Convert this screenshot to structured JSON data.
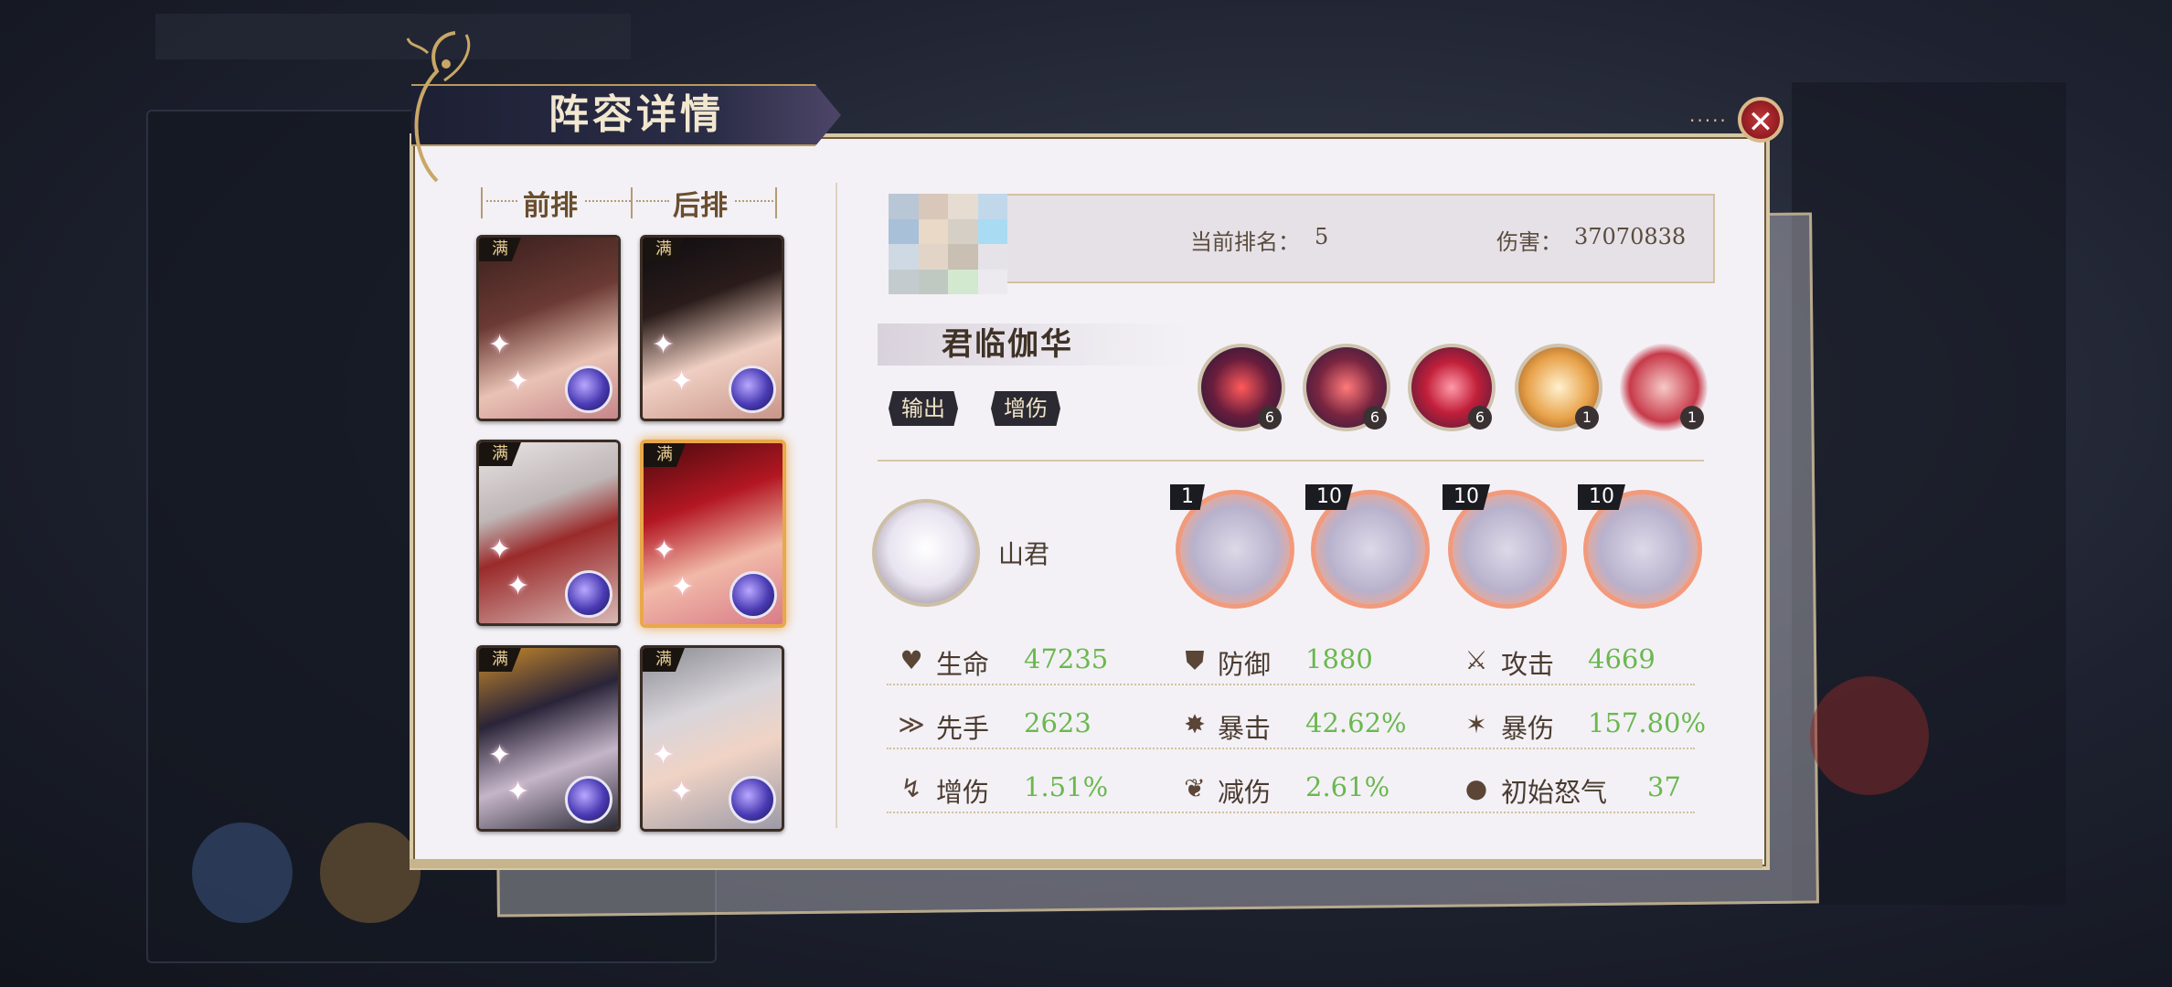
{
  "modal": {
    "title": "阵容详情",
    "close_icon": "close-icon"
  },
  "lineup": {
    "front_label": "前排",
    "back_label": "后排",
    "cards": [
      {
        "tag": "满",
        "row": "前排",
        "selected": false
      },
      {
        "tag": "满",
        "row": "后排",
        "selected": false
      },
      {
        "tag": "满",
        "row": "前排",
        "selected": false
      },
      {
        "tag": "满",
        "row": "后排",
        "selected": true
      },
      {
        "tag": "满",
        "row": "前排",
        "selected": false
      },
      {
        "tag": "满",
        "row": "后排",
        "selected": false
      }
    ]
  },
  "player": {
    "rank_label": "当前排名：",
    "rank_value": "5",
    "damage_label": "伤害：",
    "damage_value": "37070838"
  },
  "character": {
    "name": "君临伽华",
    "tags": [
      "输出",
      "增伤"
    ],
    "equips": [
      {
        "icon": "slash-skill-icon",
        "level": "6"
      },
      {
        "icon": "rose-skill-icon",
        "level": "6"
      },
      {
        "icon": "heart-skill-icon",
        "level": "6"
      },
      {
        "icon": "sun-emblem-icon",
        "level": "1"
      },
      {
        "icon": "chibi-companion-icon",
        "level": "1"
      }
    ]
  },
  "pet": {
    "name": "山君",
    "skills": [
      {
        "level": "1"
      },
      {
        "level": "10"
      },
      {
        "level": "10"
      },
      {
        "level": "10"
      }
    ]
  },
  "stats": [
    {
      "icon": "heart-icon",
      "name": "生命",
      "value": "47235"
    },
    {
      "icon": "shield-icon",
      "name": "防御",
      "value": "1880"
    },
    {
      "icon": "sword-icon",
      "name": "攻击",
      "value": "4669"
    },
    {
      "icon": "speed-icon",
      "name": "先手",
      "value": "2623"
    },
    {
      "icon": "crit-icon",
      "name": "暴击",
      "value": "42.62%"
    },
    {
      "icon": "crit-damage-icon",
      "name": "暴伤",
      "value": "157.80%"
    },
    {
      "icon": "damage-boost-icon",
      "name": "增伤",
      "value": "1.51%"
    },
    {
      "icon": "damage-reduce-icon",
      "name": "减伤",
      "value": "2.61%"
    },
    {
      "icon": "rage-drop-icon",
      "name": "初始怒气",
      "value": "37"
    }
  ],
  "colors": {
    "stat_value": "#6ab84e",
    "close_button": "#c6363a",
    "banner": "#1d2034",
    "selected_border": "#e9a84a"
  }
}
